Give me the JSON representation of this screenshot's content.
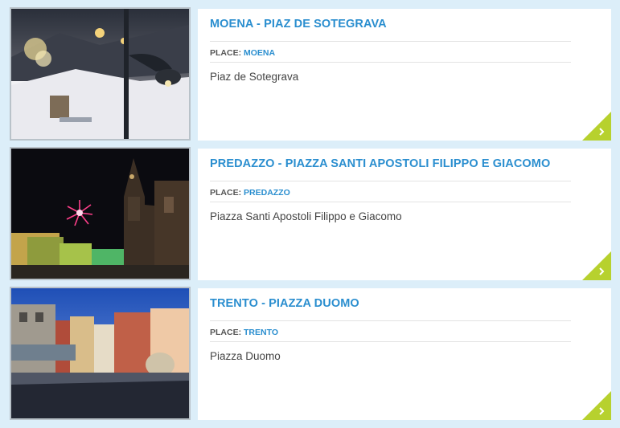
{
  "colors": {
    "background": "#dceef9",
    "title": "#2a8ecf",
    "link": "#2a8ecf",
    "accent_corner": "#b7d12e"
  },
  "events": [
    {
      "title": "MOENA - PIAZ DE SOTEGRAVA",
      "place_label": "PLACE:",
      "place_value": "MOENA",
      "address": "Piaz de Sotegrava",
      "photo": "snowy-village-square-night"
    },
    {
      "title": "PREDAZZO - PIAZZA SANTI APOSTOLI FILIPPO E GIACOMO",
      "place_label": "PLACE:",
      "place_value": "PREDAZZO",
      "address": "Piazza Santi Apostoli Filippo e Giacomo",
      "photo": "fireworks-church-square-night"
    },
    {
      "title": "TRENTO - PIAZZA DUOMO",
      "place_label": "PLACE:",
      "place_value": "TRENTO",
      "address": "Piazza Duomo",
      "photo": "cathedral-square-daytime"
    }
  ],
  "icons": {
    "more": "chevron-right-icon"
  }
}
